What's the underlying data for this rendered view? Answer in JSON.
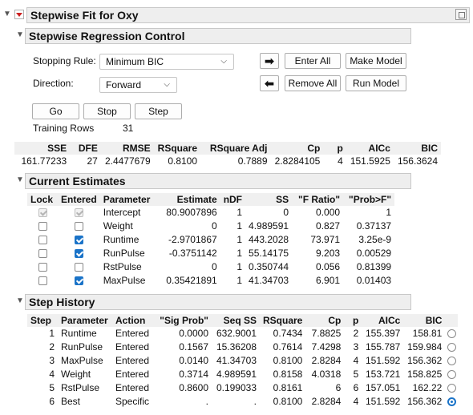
{
  "report": {
    "title": "Stepwise Fit for Oxy"
  },
  "control": {
    "title": "Stepwise Regression Control",
    "stopping_rule_label": "Stopping Rule:",
    "stopping_rule_value": "Minimum BIC",
    "direction_label": "Direction:",
    "direction_value": "Forward",
    "enter_all": "Enter All",
    "make_model": "Make Model",
    "remove_all": "Remove All",
    "run_model": "Run Model",
    "go": "Go",
    "stop": "Stop",
    "step": "Step",
    "training_rows_label": "Training Rows",
    "training_rows_value": "31"
  },
  "summary": {
    "headers": [
      "SSE",
      "DFE",
      "RMSE",
      "RSquare",
      "RSquare Adj",
      "Cp",
      "p",
      "AICc",
      "BIC"
    ],
    "values": [
      "161.77233",
      "27",
      "2.4477679",
      "0.8100",
      "0.7889",
      "2.8284105",
      "4",
      "151.5925",
      "156.3624"
    ]
  },
  "current_estimates": {
    "title": "Current Estimates",
    "headers": [
      "Lock",
      "Entered",
      "Parameter",
      "Estimate",
      "nDF",
      "SS",
      "\"F Ratio\"",
      "\"Prob>F\""
    ],
    "rows": [
      {
        "lock": true,
        "entered": true,
        "disabled": true,
        "parameter": "Intercept",
        "estimate": "80.9007896",
        "ndf": "1",
        "ss": "0",
        "f": "0.000",
        "p": "1"
      },
      {
        "lock": false,
        "entered": false,
        "disabled": false,
        "parameter": "Weight",
        "estimate": "0",
        "ndf": "1",
        "ss": "4.989591",
        "f": "0.827",
        "p": "0.37137"
      },
      {
        "lock": false,
        "entered": true,
        "disabled": false,
        "parameter": "Runtime",
        "estimate": "-2.9701867",
        "ndf": "1",
        "ss": "443.2028",
        "f": "73.971",
        "p": "3.25e-9"
      },
      {
        "lock": false,
        "entered": true,
        "disabled": false,
        "parameter": "RunPulse",
        "estimate": "-0.3751142",
        "ndf": "1",
        "ss": "55.14175",
        "f": "9.203",
        "p": "0.00529"
      },
      {
        "lock": false,
        "entered": false,
        "disabled": false,
        "parameter": "RstPulse",
        "estimate": "0",
        "ndf": "1",
        "ss": "0.350744",
        "f": "0.056",
        "p": "0.81399"
      },
      {
        "lock": false,
        "entered": true,
        "disabled": false,
        "parameter": "MaxPulse",
        "estimate": "0.35421891",
        "ndf": "1",
        "ss": "41.34703",
        "f": "6.901",
        "p": "0.01403"
      }
    ]
  },
  "step_history": {
    "title": "Step History",
    "headers": [
      "Step",
      "Parameter",
      "Action",
      "\"Sig Prob\"",
      "Seq SS",
      "RSquare",
      "Cp",
      "p",
      "AICc",
      "BIC"
    ],
    "rows": [
      {
        "step": "1",
        "parameter": "Runtime",
        "action": "Entered",
        "sig": "0.0000",
        "seqss": "632.9001",
        "rsq": "0.7434",
        "cp": "7.8825",
        "p": "2",
        "aicc": "155.397",
        "bic": "158.81",
        "selected": false
      },
      {
        "step": "2",
        "parameter": "RunPulse",
        "action": "Entered",
        "sig": "0.1567",
        "seqss": "15.36208",
        "rsq": "0.7614",
        "cp": "7.4298",
        "p": "3",
        "aicc": "155.787",
        "bic": "159.984",
        "selected": false
      },
      {
        "step": "3",
        "parameter": "MaxPulse",
        "action": "Entered",
        "sig": "0.0140",
        "seqss": "41.34703",
        "rsq": "0.8100",
        "cp": "2.8284",
        "p": "4",
        "aicc": "151.592",
        "bic": "156.362",
        "selected": false
      },
      {
        "step": "4",
        "parameter": "Weight",
        "action": "Entered",
        "sig": "0.3714",
        "seqss": "4.989591",
        "rsq": "0.8158",
        "cp": "4.0318",
        "p": "5",
        "aicc": "153.721",
        "bic": "158.825",
        "selected": false
      },
      {
        "step": "5",
        "parameter": "RstPulse",
        "action": "Entered",
        "sig": "0.8600",
        "seqss": "0.199033",
        "rsq": "0.8161",
        "cp": "6",
        "p": "6",
        "aicc": "157.051",
        "bic": "162.22",
        "selected": false
      },
      {
        "step": "6",
        "parameter": "Best",
        "action": "Specific",
        "sig": ".",
        "seqss": ".",
        "rsq": "0.8100",
        "cp": "2.8284",
        "p": "4",
        "aicc": "151.592",
        "bic": "156.362",
        "selected": true
      }
    ]
  }
}
